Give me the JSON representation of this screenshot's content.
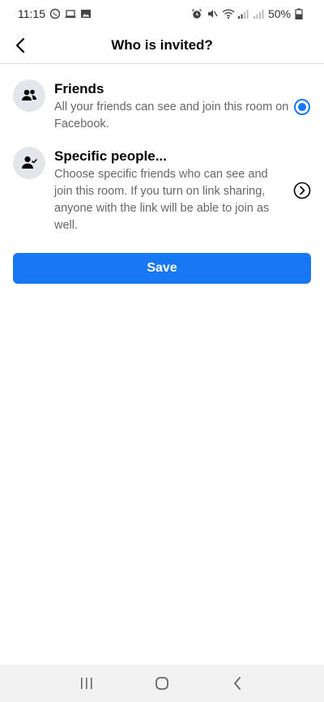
{
  "status_bar": {
    "time": "11:15",
    "battery": "50%"
  },
  "header": {
    "title": "Who is invited?"
  },
  "options": [
    {
      "title": "Friends",
      "description": "All your friends can see and join this room on Facebook.",
      "icon": "friends-icon",
      "control": "radio",
      "selected": true
    },
    {
      "title": "Specific people...",
      "description": "Choose specific friends who can see and join this room. If you turn on link sharing, anyone with the link will be able to join as well.",
      "icon": "specific-person-icon",
      "control": "chevron"
    }
  ],
  "save_button": {
    "label": "Save"
  },
  "colors": {
    "accent": "#1877f2",
    "icon_bg": "#e4e6eb",
    "secondary_text": "#65676b"
  }
}
